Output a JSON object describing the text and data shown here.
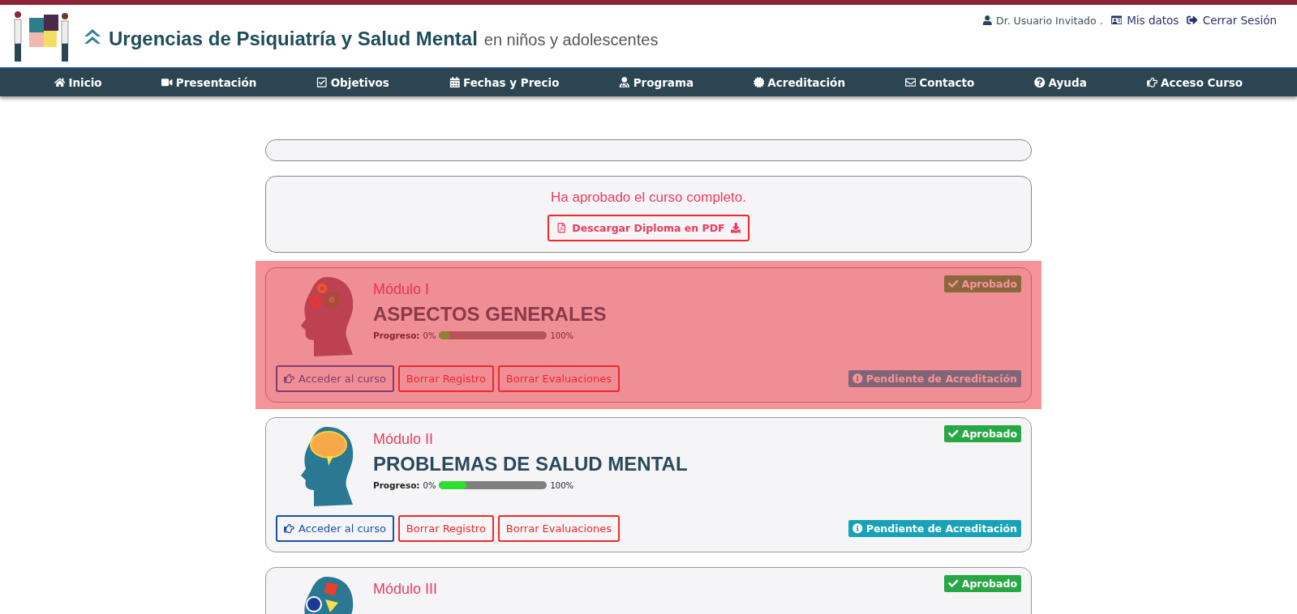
{
  "header": {
    "title": "Urgencias de Psiquiatría y Salud Mental",
    "subtitle": "en niños y adolescentes",
    "user": "Dr. Usuario Invitado .",
    "links": [
      "Mis datos",
      "Cerrar Sesión"
    ]
  },
  "nav": [
    "Inicio",
    "Presentación",
    "Objetivos",
    "Fechas y Precio",
    "Programa",
    "Acreditación",
    "Contacto",
    "Ayuda",
    "Acceso Curso"
  ],
  "completion": {
    "message": "Ha aprobado el curso completo.",
    "button": "Descargar Diploma en PDF"
  },
  "modules": [
    {
      "number": "Módulo I",
      "title": "ASPECTOS GENERALES",
      "highlighted": true,
      "progress_label": "Progreso:",
      "progress_start": "0%",
      "level": 0.1,
      "progress_end": "100%",
      "status": "Aprobado",
      "accreditation": "Pendiente de Acreditación",
      "buttons": [
        "Acceder al curso",
        "Borrar Registro",
        "Borrar Evaluaciones"
      ]
    },
    {
      "number": "Módulo II",
      "title": "PROBLEMAS DE SALUD MENTAL",
      "highlighted": false,
      "progress_label": "Progreso:",
      "progress_start": "0%",
      "level": 0.25,
      "progress_end": "100%",
      "status": "Aprobado",
      "accreditation": "Pendiente de Acreditación",
      "buttons": [
        "Acceder al curso",
        "Borrar Registro",
        "Borrar Evaluaciones"
      ]
    },
    {
      "number": "Módulo III",
      "highlighted": false,
      "status": "Aprobado"
    }
  ]
}
